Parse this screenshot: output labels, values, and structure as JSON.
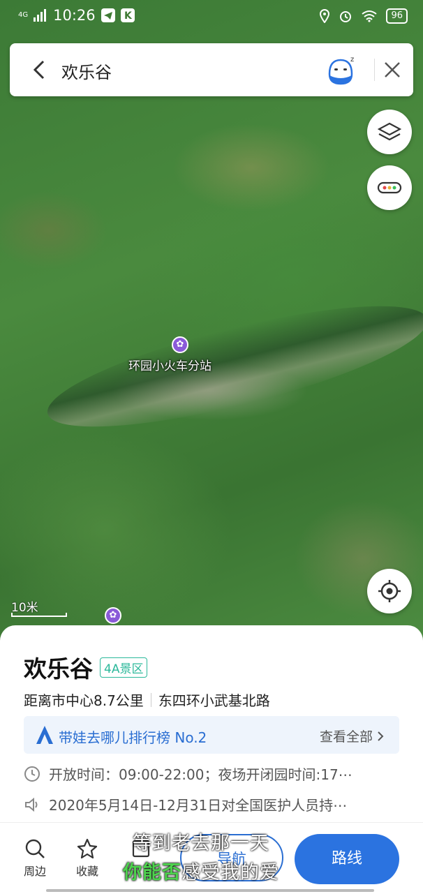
{
  "status_bar": {
    "network": "4G",
    "time": "10:26",
    "battery": "96"
  },
  "search": {
    "query": "欢乐谷"
  },
  "map": {
    "poi_label": "环园小火车分站",
    "scale_label": "10米"
  },
  "place": {
    "name": "欢乐谷",
    "tag": "4A景区",
    "distance": "距离市中心8.7公里",
    "address": "东四环小武基北路",
    "ranking": "带娃去哪儿排行榜 No.2",
    "ranking_more": "查看全部",
    "hours": "开放时间：09:00-22:00；夜场开闭园时间:17⋯",
    "announcement": "2020年5月14日-12月31日对全国医护人员持⋯"
  },
  "tabbar": {
    "nearby": "周边",
    "favorite": "收藏",
    "navigate": "导航",
    "route": "路线"
  },
  "subtitles": {
    "line1": "等到老去那一天",
    "line2_green": "你能否",
    "line2_rest": "感受我的爱"
  },
  "colors": {
    "primary": "#2b73e0",
    "tag": "#2bb89a",
    "poi": "#8a5ad8"
  }
}
